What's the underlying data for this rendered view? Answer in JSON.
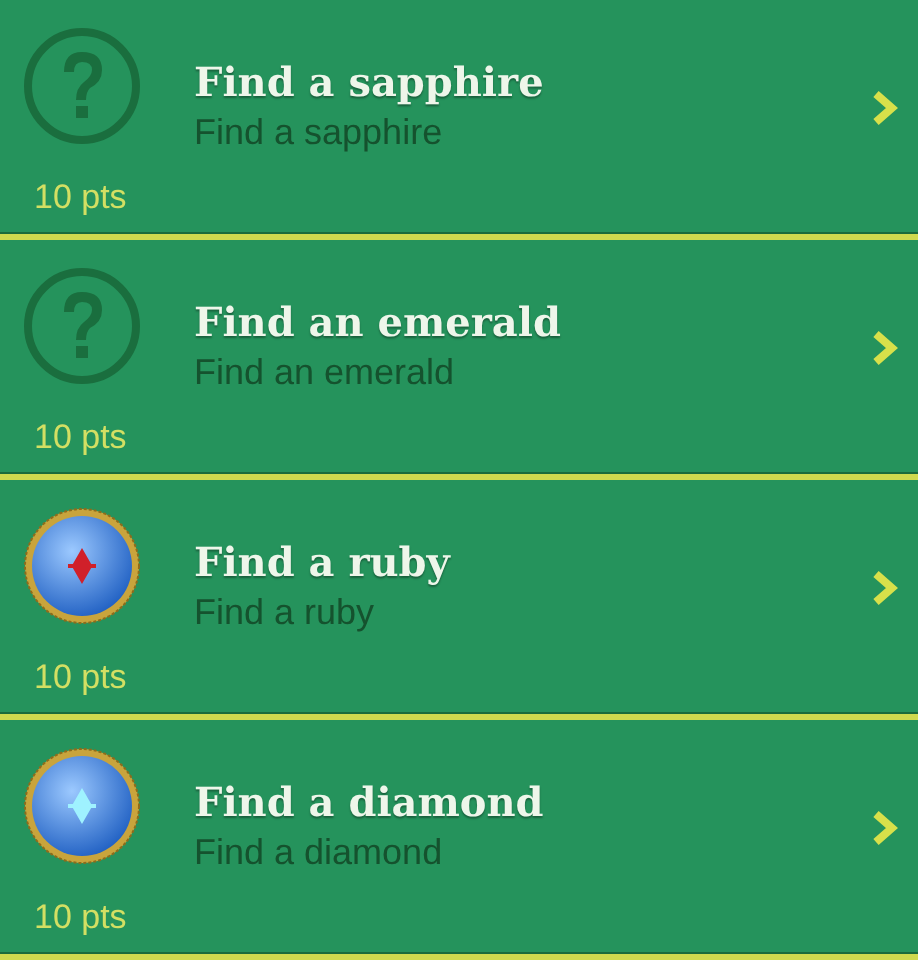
{
  "achievements": [
    {
      "kind": "locked",
      "title": "Find a sapphire",
      "subtitle": "Find a sapphire",
      "points": "10 pts"
    },
    {
      "kind": "locked",
      "title": "Find an emerald",
      "subtitle": "Find an emerald",
      "points": "10 pts"
    },
    {
      "kind": "earned",
      "color": "#d0202a",
      "title": "Find a ruby",
      "subtitle": "Find a ruby",
      "points": "10 pts"
    },
    {
      "kind": "earned",
      "color": "#9ff2ff",
      "title": "Find a diamond",
      "subtitle": "Find a diamond",
      "points": "10 pts"
    }
  ]
}
